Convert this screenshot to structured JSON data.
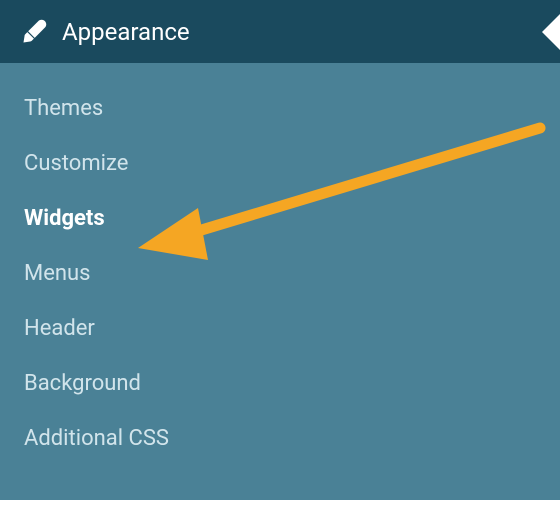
{
  "menu": {
    "header": {
      "label": "Appearance",
      "icon": "paintbrush-icon"
    },
    "items": [
      {
        "label": "Themes",
        "selected": false
      },
      {
        "label": "Customize",
        "selected": false
      },
      {
        "label": "Widgets",
        "selected": true
      },
      {
        "label": "Menus",
        "selected": false
      },
      {
        "label": "Header",
        "selected": false
      },
      {
        "label": "Background",
        "selected": false
      },
      {
        "label": "Additional CSS",
        "selected": false
      }
    ]
  },
  "annotation": {
    "arrow_color": "#f5a623"
  }
}
